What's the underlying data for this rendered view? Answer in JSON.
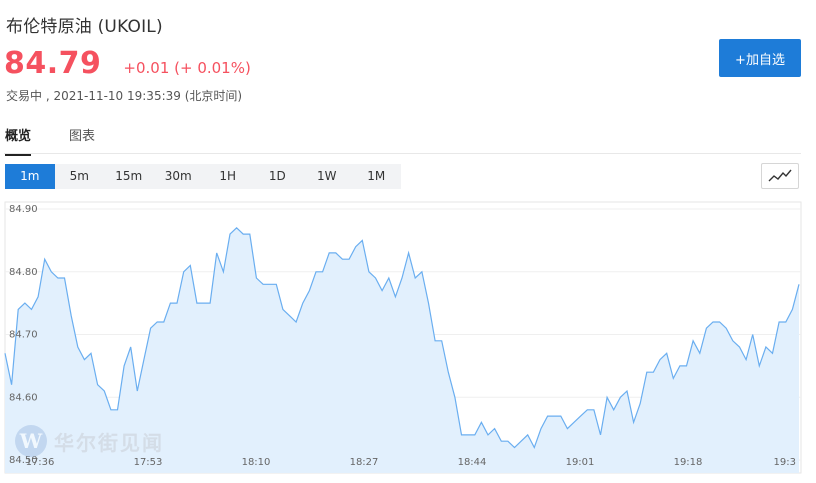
{
  "header": {
    "title": "布伦特原油 (UKOIL)",
    "price": "84.79",
    "change": "+0.01 (+ 0.01%)",
    "status": "交易中 , 2021-11-10 19:35:39 (北京时间)",
    "add_button": "+加自选"
  },
  "tabs": [
    {
      "label": "概览",
      "active": true
    },
    {
      "label": "图表",
      "active": false
    }
  ],
  "intervals": [
    "1m",
    "5m",
    "15m",
    "30m",
    "1H",
    "1D",
    "1W",
    "1M"
  ],
  "active_interval": "1m",
  "chart_type_icon": "line-chart-icon",
  "watermark": "华尔街见闻",
  "colors": {
    "accent": "#1e7cd8",
    "price_up": "#f5515f",
    "line": "#6aaef0",
    "area": "#e2f0fd"
  },
  "chart_data": {
    "type": "area",
    "x_ticks": [
      "17:36",
      "17:53",
      "18:10",
      "18:27",
      "18:44",
      "19:01",
      "19:18",
      "19:3"
    ],
    "y_ticks": [
      "84.50",
      "84.60",
      "84.70",
      "84.80",
      "84.90"
    ],
    "ylim": [
      84.5,
      84.9
    ],
    "grid": true,
    "x_range": [
      0,
      120
    ],
    "series": [
      {
        "x": [
          0,
          1,
          2,
          3,
          4,
          5,
          6,
          7,
          8,
          9,
          10,
          11,
          12,
          13,
          14,
          15,
          16,
          17,
          18,
          19,
          20,
          21,
          22,
          23,
          24,
          25,
          26,
          27,
          28,
          29,
          30,
          31,
          32,
          33,
          34,
          35,
          36,
          37,
          38,
          39,
          40,
          41,
          42,
          43,
          44,
          45,
          46,
          47,
          48,
          49,
          50,
          51,
          52,
          53,
          54,
          55,
          56,
          57,
          58,
          59,
          60,
          61,
          62,
          63,
          64,
          65,
          66,
          67,
          68,
          69,
          70,
          71,
          72,
          73,
          74,
          75,
          76,
          77,
          78,
          79,
          80,
          81,
          82,
          83,
          84,
          85,
          86,
          87,
          88,
          89,
          90,
          91,
          92,
          93,
          94,
          95,
          96,
          97,
          98,
          99,
          100,
          101,
          102,
          103,
          104,
          105,
          106,
          107,
          108,
          109,
          110,
          111,
          112,
          113,
          114,
          115,
          116,
          117,
          118,
          119,
          120
        ],
        "values": [
          84.67,
          84.62,
          84.74,
          84.75,
          84.74,
          84.76,
          84.82,
          84.8,
          84.79,
          84.79,
          84.73,
          84.68,
          84.66,
          84.67,
          84.62,
          84.61,
          84.58,
          84.58,
          84.65,
          84.68,
          84.61,
          84.66,
          84.71,
          84.72,
          84.72,
          84.75,
          84.75,
          84.8,
          84.81,
          84.75,
          84.75,
          84.75,
          84.83,
          84.8,
          84.86,
          84.87,
          84.86,
          84.86,
          84.79,
          84.78,
          84.78,
          84.78,
          84.74,
          84.73,
          84.72,
          84.75,
          84.77,
          84.8,
          84.8,
          84.83,
          84.83,
          84.82,
          84.82,
          84.84,
          84.85,
          84.8,
          84.79,
          84.77,
          84.79,
          84.76,
          84.79,
          84.83,
          84.79,
          84.8,
          84.75,
          84.69,
          84.69,
          84.64,
          84.6,
          84.54,
          84.54,
          84.54,
          84.56,
          84.54,
          84.55,
          84.53,
          84.53,
          84.52,
          84.53,
          84.54,
          84.52,
          84.55,
          84.57,
          84.57,
          84.57,
          84.55,
          84.56,
          84.57,
          84.58,
          84.58,
          84.54,
          84.6,
          84.58,
          84.6,
          84.61,
          84.56,
          84.59,
          84.64,
          84.64,
          84.66,
          84.67,
          84.63,
          84.65,
          84.65,
          84.69,
          84.67,
          84.71,
          84.72,
          84.72,
          84.71,
          84.69,
          84.68,
          84.66,
          84.7,
          84.65,
          84.68,
          84.67,
          84.72,
          84.72,
          84.74,
          84.78
        ]
      }
    ]
  }
}
